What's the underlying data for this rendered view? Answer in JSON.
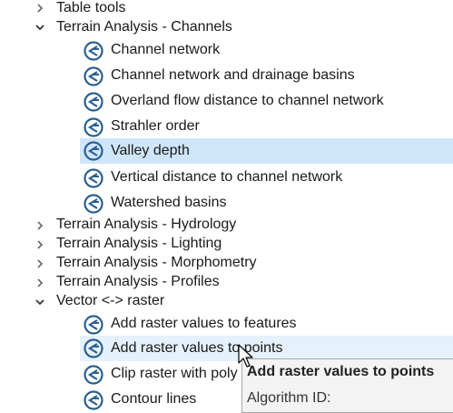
{
  "tree": {
    "collapsed_top": "Table tools",
    "channels_group": "Terrain Analysis - Channels",
    "channels_items": [
      "Channel network",
      "Channel network and drainage basins",
      "Overland flow distance to channel network",
      "Strahler order",
      "Valley depth",
      "Vertical distance to channel network",
      "Watershed basins"
    ],
    "hydrology_group": "Terrain Analysis - Hydrology",
    "lighting_group": "Terrain Analysis - Lighting",
    "morphometry_group": "Terrain Analysis - Morphometry",
    "profiles_group": "Terrain Analysis - Profiles",
    "vector_raster_group": "Vector <-> raster",
    "vector_raster_items": [
      "Add raster values to features",
      "Add raster values to points",
      "Clip raster with poly",
      "Contour lines"
    ],
    "selected_item": "Valley depth",
    "hovered_item": "Add raster values to points"
  },
  "tooltip": {
    "title": "Add raster values to points",
    "meta_label": "Algorithm ID:"
  },
  "colors": {
    "selection": "#cfe6fa",
    "hover": "#e5f1fb",
    "icon_blue": "#2b5f8f"
  },
  "icons": {
    "algorithm": "saga-algorithm-icon",
    "collapsed": "chevron-right-icon",
    "expanded": "chevron-down-icon"
  }
}
